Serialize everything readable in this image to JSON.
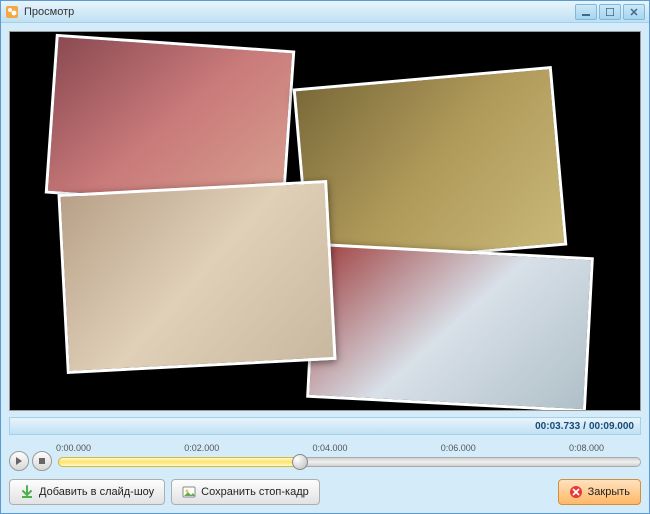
{
  "window": {
    "title": "Просмотр"
  },
  "time": {
    "current": "00:03.733",
    "total": "00:09.000"
  },
  "timeline": {
    "ticks": [
      "0:00.000",
      "0:02.000",
      "0:04.000",
      "0:06.000",
      "0:08.000"
    ],
    "progress_pct": 41.5,
    "max_seconds": 9.0,
    "tick_spacing_seconds": 2.0
  },
  "buttons": {
    "add_slideshow": "Добавить в слайд-шоу",
    "save_frame": "Сохранить стоп-кадр",
    "close": "Закрыть"
  },
  "colors": {
    "titlebar": "#bfe1f4",
    "accent": "#5a9bd4",
    "close_btn": "#ffb865"
  }
}
